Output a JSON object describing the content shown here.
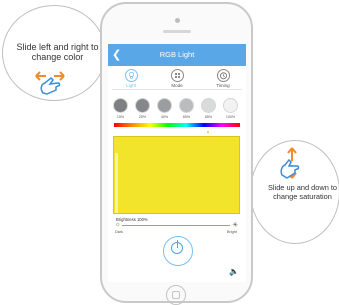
{
  "app": {
    "title": "RGB Light",
    "back_icon": "back-arrow-icon"
  },
  "tabs": [
    {
      "label": "Light",
      "icon": "lightbulb-icon",
      "active": true
    },
    {
      "label": "Mode",
      "icon": "mode-dial-icon",
      "active": false
    },
    {
      "label": "Timing",
      "icon": "alarm-clock-icon",
      "active": false
    }
  ],
  "presets": [
    {
      "label": "15%",
      "color": "#7d7f83"
    },
    {
      "label": "25%",
      "color": "#85878a"
    },
    {
      "label": "40%",
      "color": "#9b9da0"
    },
    {
      "label": "65%",
      "color": "#babcbe"
    },
    {
      "label": "85%",
      "color": "#d9dadb"
    },
    {
      "label": "100%",
      "color": "#f2f2f2"
    }
  ],
  "color_panel": {
    "color": "#f2e32b"
  },
  "brightness": {
    "label": "Brightness 100%",
    "value_percent": 100,
    "min_label": "Dark",
    "max_label": "Bright"
  },
  "instructions": {
    "left": "Slide left and right to change color",
    "right": "Slide up and down to change saturation"
  },
  "colors": {
    "header": "#5aa7e8",
    "accent": "#48a4ea"
  }
}
